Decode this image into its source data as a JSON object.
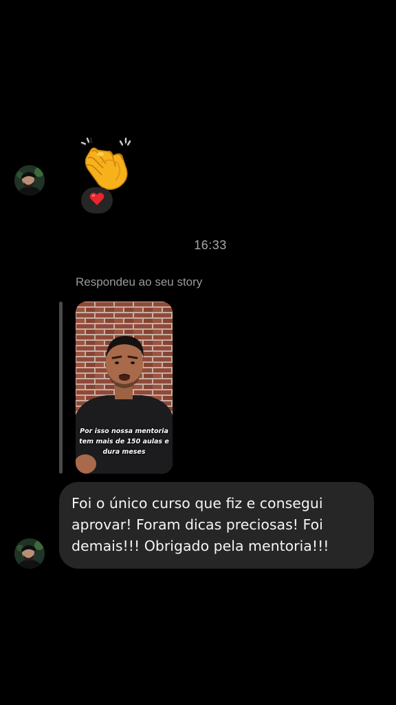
{
  "conversation": {
    "first_message": {
      "emoji": "clapping-hands",
      "reaction_emoji": "heart"
    },
    "timestamp": "16:33",
    "story_reply": {
      "note": "Respondeu ao seu story",
      "caption": "Por isso nossa mentoria tem mais de 150 aulas e dura meses"
    },
    "message": {
      "text": "Foi o único curso que fiz e consegui aprovar! Foram dicas preciosas! Foi demais!!! Obrigado pela mentoria!!!"
    }
  },
  "colors": {
    "background": "#000000",
    "bubble": "#262626",
    "secondary_text": "#a8a8a8",
    "heart": "#e8262b"
  }
}
